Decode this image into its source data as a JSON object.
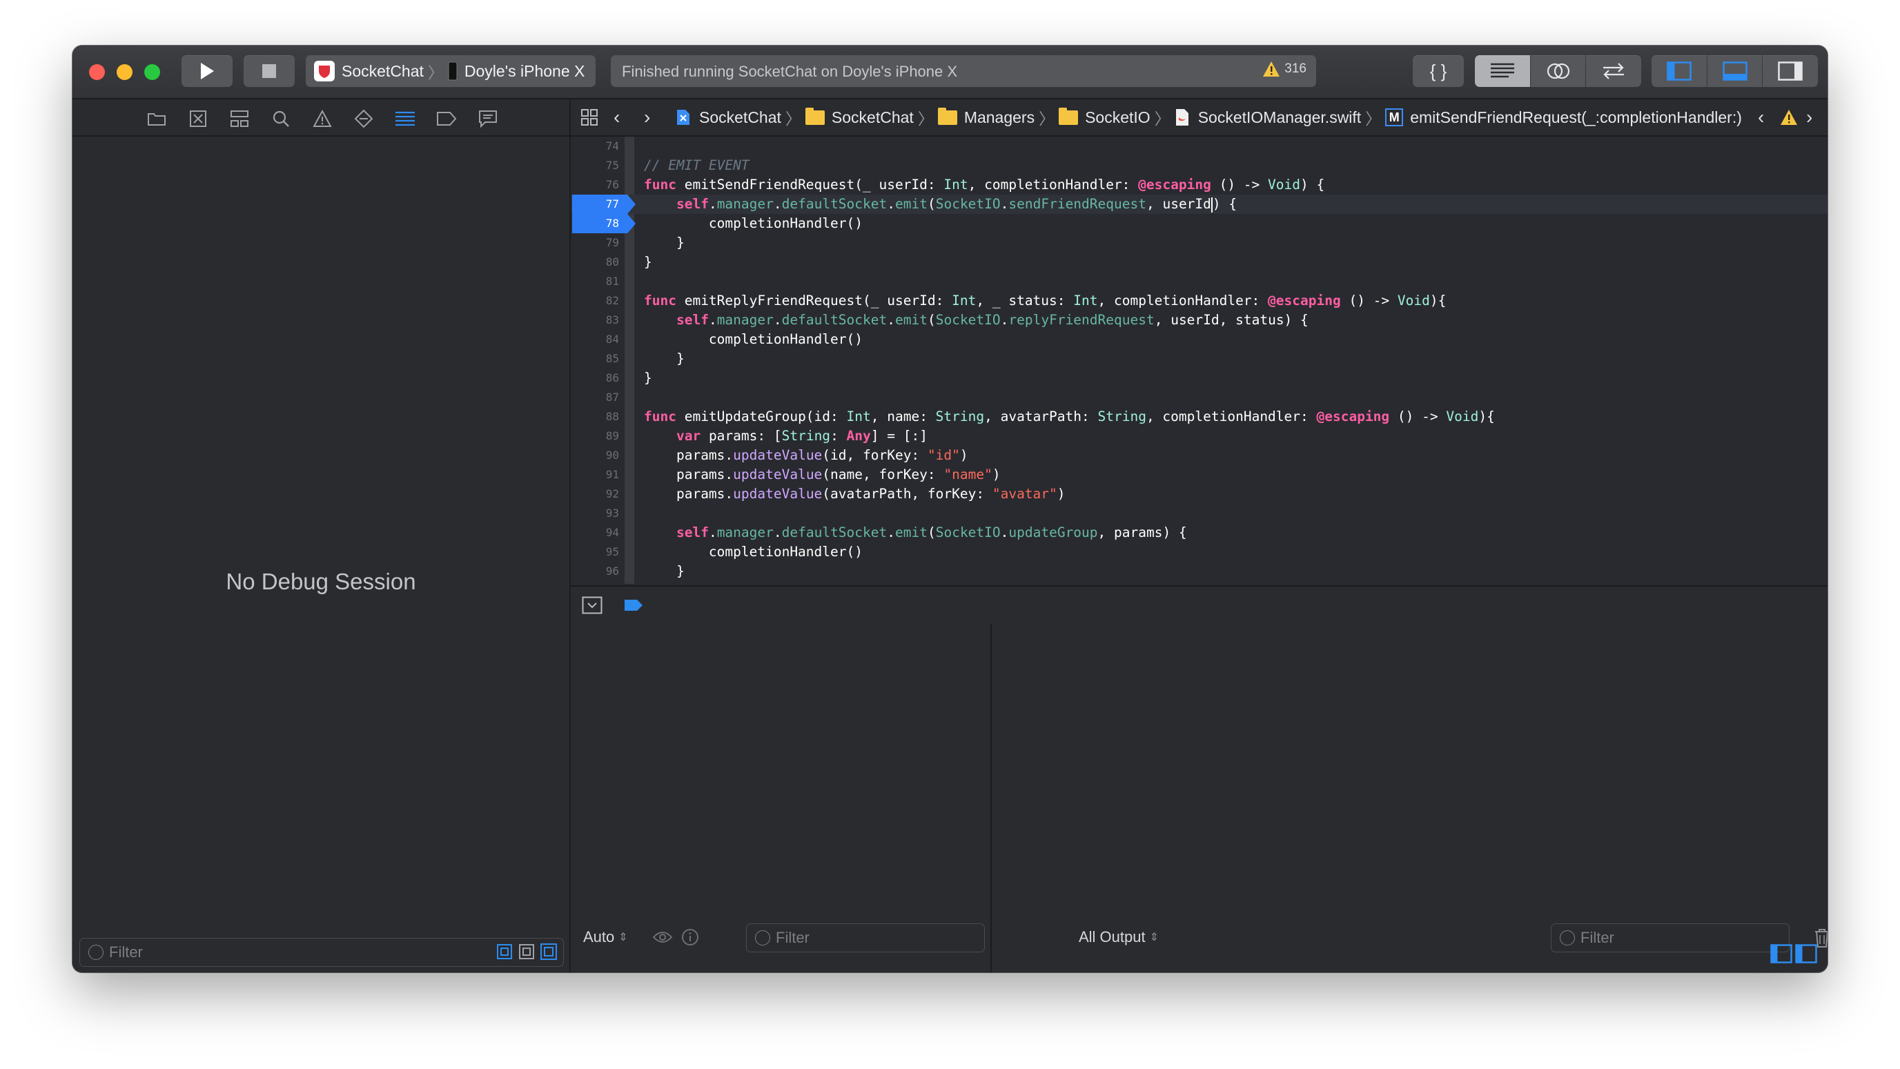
{
  "toolbar": {
    "scheme_name": "SocketChat",
    "device_name": "Doyle's iPhone X",
    "activity_status": "Finished running SocketChat on Doyle's iPhone X",
    "warning_count": "316",
    "icons": [
      "run-icon",
      "stop-icon",
      "code-snippet-icon",
      "standard-editor-icon",
      "assistant-editor-icon",
      "version-editor-icon",
      "left-panel-icon",
      "bottom-panel-icon",
      "right-panel-icon"
    ]
  },
  "navigator": {
    "icons": [
      "folder-icon",
      "source-control-icon",
      "hierarchy-icon",
      "search-icon",
      "warning-icon",
      "test-icon",
      "debug-icon",
      "breakpoint-icon",
      "report-icon"
    ],
    "empty_message": "No Debug Session",
    "filter_placeholder": "Filter"
  },
  "jumpbar": {
    "crumbs": [
      "SocketChat",
      "SocketChat",
      "Managers",
      "SocketIO",
      "SocketIOManager.swift",
      "emitSendFriendRequest(_:completionHandler:)"
    ],
    "method_badge": "M"
  },
  "editor": {
    "current_line": 77,
    "breakpoint_lines": [
      77,
      78
    ],
    "lines": [
      {
        "n": "74"
      },
      {
        "n": "75"
      },
      {
        "n": "76"
      },
      {
        "n": "77"
      },
      {
        "n": "78"
      },
      {
        "n": "79"
      },
      {
        "n": "80"
      },
      {
        "n": "81"
      },
      {
        "n": "82"
      },
      {
        "n": "83"
      },
      {
        "n": "84"
      },
      {
        "n": "85"
      },
      {
        "n": "86"
      },
      {
        "n": "87"
      },
      {
        "n": "88"
      },
      {
        "n": "89"
      },
      {
        "n": "90"
      },
      {
        "n": "91"
      },
      {
        "n": "92"
      },
      {
        "n": "93"
      },
      {
        "n": "94"
      },
      {
        "n": "95"
      },
      {
        "n": "96"
      }
    ],
    "tokens": {
      "l75": {
        "comment": "// EMIT EVENT"
      },
      "l76": {
        "kw": "func",
        "name": " emitSendFriendRequest(_ userId: ",
        "t1": "Int",
        "p1": ", completionHandler: ",
        "attr": "@escaping",
        "p2": " () -> ",
        "t2": "Void",
        "p3": ") {"
      },
      "l77": {
        "self": "self",
        "p1": ".",
        "m1": "manager",
        "p2": ".",
        "m2": "defaultSocket",
        "p3": ".",
        "m3": "emit",
        "p4": "(",
        "ty": "SocketIO",
        "p5": ".",
        "m4": "sendFriendRequest",
        "p6": ", userId",
        "p7": ") {"
      },
      "l78": {
        "text": "completionHandler()"
      },
      "l79": {
        "text": "}"
      },
      "l80": {
        "text": "}"
      },
      "l82": {
        "kw": "func",
        "name": " emitReplyFriendRequest(_ userId: ",
        "t1": "Int",
        "p1": ", _ status: ",
        "t2": "Int",
        "p2": ", completionHandler: ",
        "attr": "@escaping",
        "p3": " () -> ",
        "t3": "Void",
        "p4": "){"
      },
      "l83": {
        "self": "self",
        "p1": ".",
        "m1": "manager",
        "p2": ".",
        "m2": "defaultSocket",
        "p3": ".",
        "m3": "emit",
        "p4": "(",
        "ty": "SocketIO",
        "p5": ".",
        "m4": "replyFriendRequest",
        "p6": ", userId, status) {"
      },
      "l84": {
        "text": "completionHandler()"
      },
      "l85": {
        "text": "}"
      },
      "l86": {
        "text": "}"
      },
      "l88": {
        "kw": "func",
        "name": " emitUpdateGroup(id: ",
        "t1": "Int",
        "p1": ", name: ",
        "t2": "String",
        "p2": ", avatarPath: ",
        "t3": "String",
        "p3": ", completionHandler: ",
        "attr": "@escaping",
        "p4": " () -> ",
        "t4": "Void",
        "p5": "){"
      },
      "l89": {
        "kw": "var",
        "p1": " params: [",
        "t1": "String",
        "p2": ": ",
        "t2": "Any",
        "p3": "] = [:]"
      },
      "l90": {
        "p1": "params.",
        "m1": "updateValue",
        "p2": "(id, forKey: ",
        "s": "\"id\"",
        "p3": ")"
      },
      "l91": {
        "p1": "params.",
        "m1": "updateValue",
        "p2": "(name, forKey: ",
        "s": "\"name\"",
        "p3": ")"
      },
      "l92": {
        "p1": "params.",
        "m1": "updateValue",
        "p2": "(avatarPath, forKey: ",
        "s": "\"avatar\"",
        "p3": ")"
      },
      "l94": {
        "self": "self",
        "p1": ".",
        "m1": "manager",
        "p2": ".",
        "m2": "defaultSocket",
        "p3": ".",
        "m3": "emit",
        "p4": "(",
        "ty": "SocketIO",
        "p5": ".",
        "m4": "updateGroup",
        "p6": ", params) {"
      },
      "l95": {
        "text": "completionHandler()"
      },
      "l96": {
        "text": "}"
      }
    }
  },
  "debug": {
    "variables_scope": "Auto",
    "variables_filter_placeholder": "Filter",
    "console_output": "All Output",
    "console_filter_placeholder": "Filter"
  },
  "colors": {
    "accent": "#2f7df6",
    "keyword": "#fc5fa3",
    "type": "#9ef1dd",
    "string": "#fc6a5d",
    "comment": "#6c7986",
    "warning": "#f5c542"
  }
}
